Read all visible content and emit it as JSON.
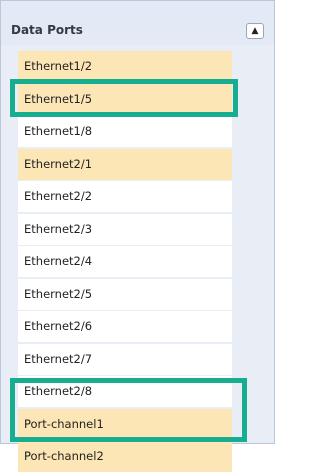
{
  "panel": {
    "title": "Data Ports",
    "collapse_icon": "▲"
  },
  "ports": [
    {
      "label": "Ethernet1/2",
      "highlighted": true
    },
    {
      "label": "Ethernet1/5",
      "highlighted": true
    },
    {
      "label": "Ethernet1/8",
      "highlighted": false
    },
    {
      "label": "Ethernet2/1",
      "highlighted": true
    },
    {
      "label": "Ethernet2/2",
      "highlighted": false
    },
    {
      "label": "Ethernet2/3",
      "highlighted": false
    },
    {
      "label": "Ethernet2/4",
      "highlighted": false
    },
    {
      "label": "Ethernet2/5",
      "highlighted": false
    },
    {
      "label": "Ethernet2/6",
      "highlighted": false
    },
    {
      "label": "Ethernet2/7",
      "highlighted": false
    },
    {
      "label": "Ethernet2/8",
      "highlighted": false
    },
    {
      "label": "Port-channel1",
      "highlighted": true
    },
    {
      "label": "Port-channel2",
      "highlighted": true
    }
  ],
  "colors": {
    "highlight": "#fde6b6",
    "annotation": "#16ad91"
  }
}
